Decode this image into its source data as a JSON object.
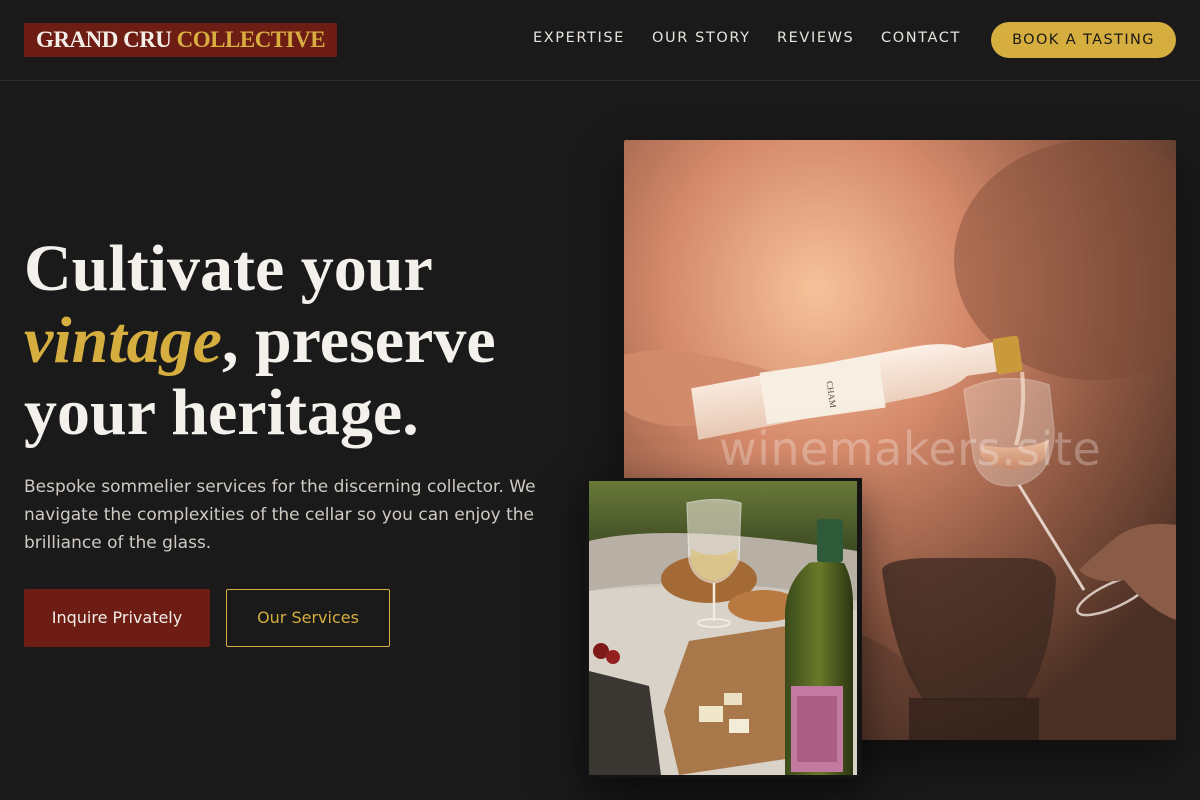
{
  "header": {
    "logo_part1": "GRAND CRU",
    "logo_part2": "COLLECTIVE",
    "nav": [
      "EXPERTISE",
      "OUR STORY",
      "REVIEWS",
      "CONTACT"
    ],
    "cta_label": "BOOK A TASTING"
  },
  "hero": {
    "headline_line1": "Cultivate your",
    "headline_em": "vintage",
    "headline_line2_rest": ", preserve",
    "headline_line3": "your heritage.",
    "lede": "Bespoke sommelier services for the discerning collector. We navigate the complexities of the cellar so you can enjoy the brilliance of the glass.",
    "primary_button": "Inquire Privately",
    "secondary_button": "Our Services"
  },
  "images": {
    "main_watermark": "winemakers.site",
    "main_icon": "wine-pour-photo",
    "inset_icon": "picnic-wine-photo",
    "bottle_label": "CHAM"
  },
  "colors": {
    "background": "#1a1a1a",
    "accent_gold": "#d5ae3f",
    "burgundy": "#6e1d15",
    "text": "#f4f1ec"
  }
}
